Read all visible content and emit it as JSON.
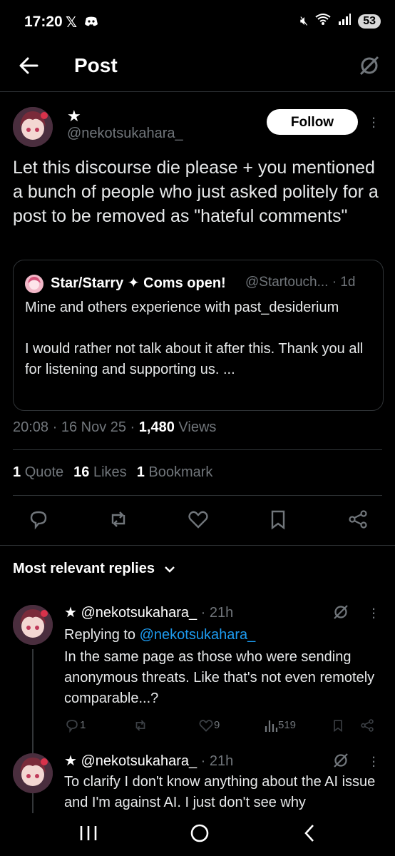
{
  "status": {
    "time": "17:20",
    "battery": "53"
  },
  "header": {
    "title": "Post"
  },
  "post": {
    "star": "★",
    "handle": "@nekotsukahara_",
    "follow_label": "Follow",
    "text": "Let this discourse die please + you mentioned a bunch of people who just asked politely for a post to be removed as \"hateful comments\"",
    "quote": {
      "name": "Star/Starry ✦ Coms open!",
      "handle": "@Startouch... · 1d",
      "text": "Mine and others experience with past_desiderium\n\nI would rather not talk about it after this. Thank you all for listening and supporting us. ..."
    },
    "time": "20:08 · 16 Nov 25 · ",
    "views_count": "1,480",
    "views_label": " Views",
    "stats": {
      "quotes_count": "1",
      "quotes_label": "Quote",
      "likes_count": "16",
      "likes_label": "Likes",
      "bookmarks_count": "1",
      "bookmarks_label": "Bookmark"
    }
  },
  "replies_sort": "Most relevant replies",
  "replies": [
    {
      "name": "★ @nekotsukahara_",
      "time": " · 21h",
      "replying_prefix": "Replying to ",
      "replying_to": "@nekotsukahara_",
      "text": "In the same page as those who were sending anonymous threats. Like that's not even remotely comparable...?",
      "replies": "1",
      "likes": "9",
      "views": "519"
    },
    {
      "name": "★ @nekotsukahara_",
      "time": " · 21h",
      "text": "To clarify I don't know anything about the AI issue and I'm against AI. I just don't see why"
    }
  ],
  "colors": {
    "accent": "#1d9bf0",
    "muted": "#71767b",
    "border": "#2f3336"
  }
}
